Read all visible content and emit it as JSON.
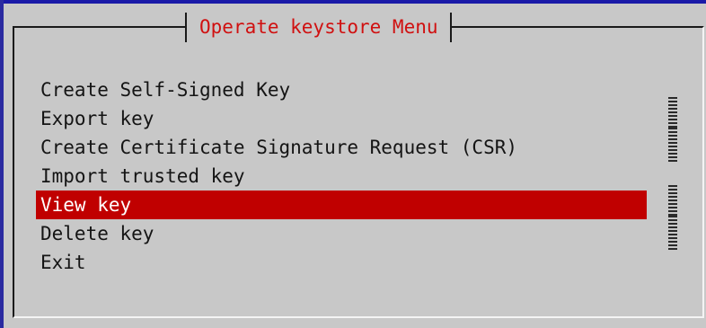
{
  "dialog": {
    "title": "Operate keystore Menu"
  },
  "menu": {
    "items": [
      {
        "label": "Create Self-Signed Key",
        "selected": false
      },
      {
        "label": "Export key",
        "selected": false
      },
      {
        "label": "Create Certificate Signature Request (CSR)",
        "selected": false
      },
      {
        "label": "Import trusted key",
        "selected": false
      },
      {
        "label": "View key",
        "selected": true
      },
      {
        "label": "Delete key",
        "selected": false
      },
      {
        "label": "Exit",
        "selected": false
      }
    ]
  },
  "colors": {
    "background": "#c8c8c8",
    "title_text": "#d01010",
    "selection": "#c00000",
    "frame_dark": "#1a1a1a",
    "frame_light": "#f4f4f4",
    "terminal_blue": "#1a1aa8"
  },
  "icons": {
    "scroll_marker": "scroll-indicator-icon"
  }
}
